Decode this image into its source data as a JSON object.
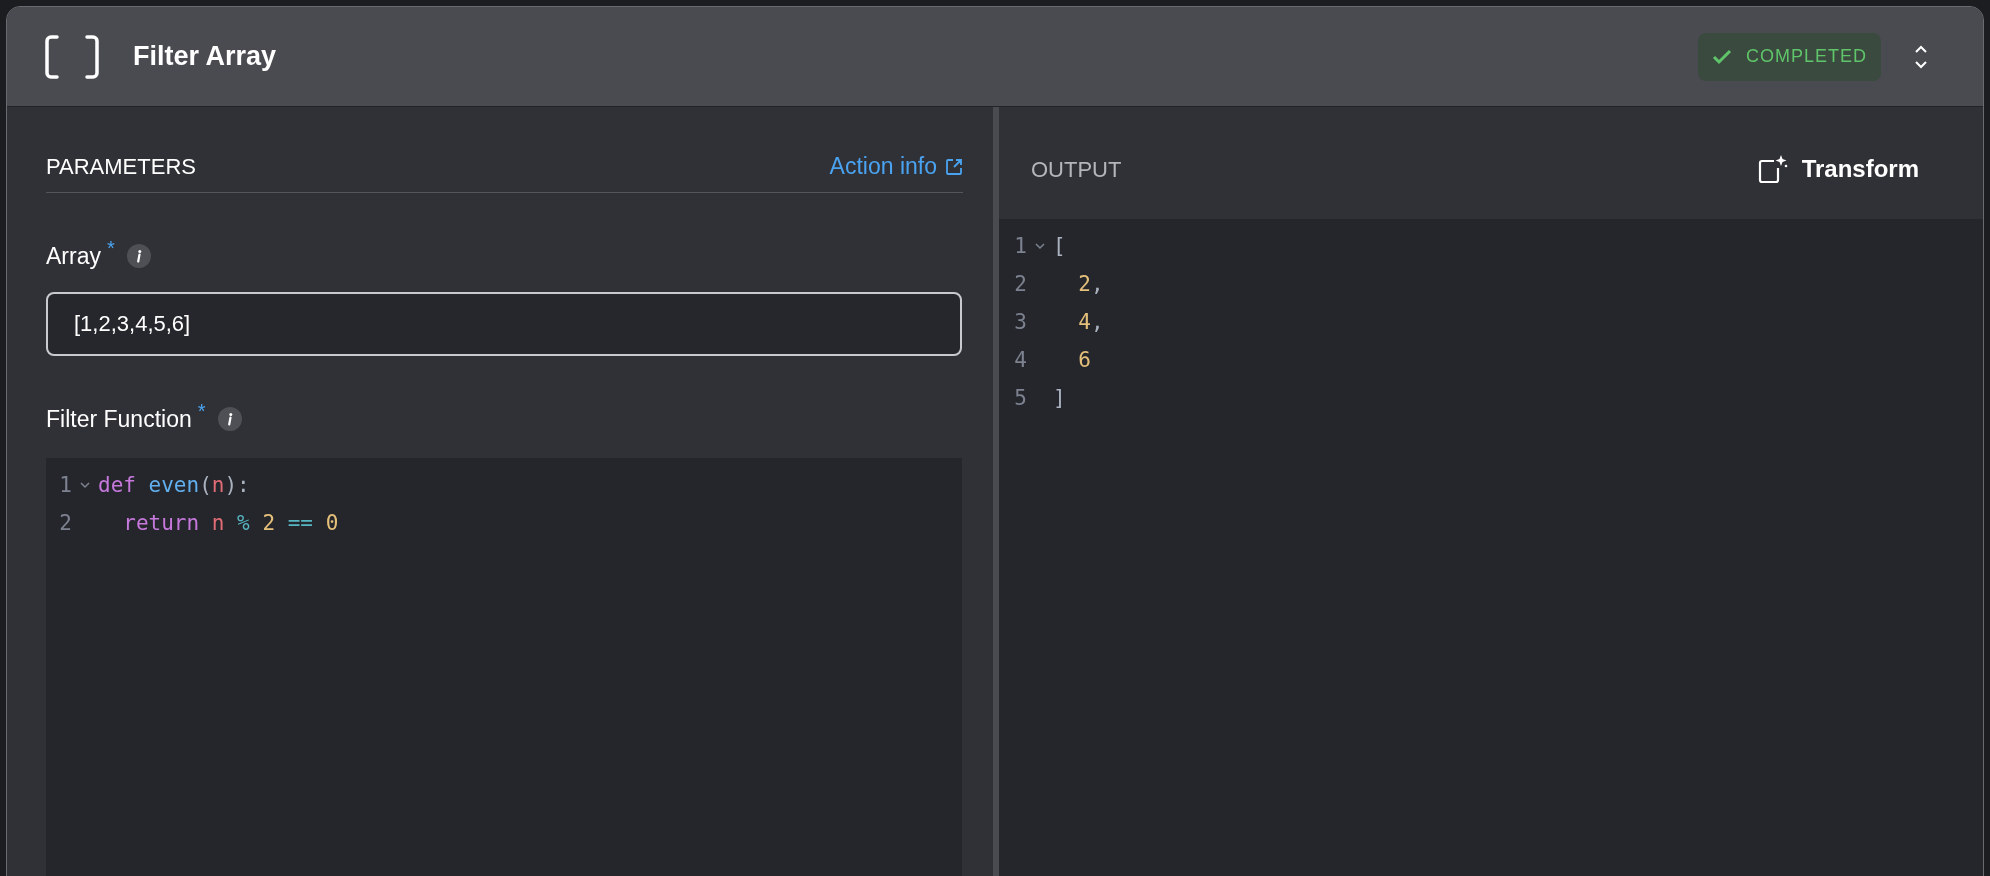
{
  "header": {
    "title": "Filter Array",
    "status": {
      "label": "COMPLETED",
      "kind": "success"
    }
  },
  "parameters": {
    "heading": "PARAMETERS",
    "link": "Action info",
    "fields": [
      {
        "kind": "input",
        "label": "Array",
        "required_mark": "*",
        "value": "[1,2,3,4,5,6]"
      },
      {
        "kind": "code",
        "label": "Filter Function",
        "required_mark": "*",
        "lines": [
          {
            "number": "1",
            "foldable": true,
            "tokens": [
              {
                "text": "def",
                "kind": "keyword"
              },
              {
                "text": " even",
                "kind": "function"
              },
              {
                "text": "(",
                "kind": "punct"
              },
              {
                "text": "n",
                "kind": "variable"
              },
              {
                "text": "):",
                "kind": "punct"
              }
            ]
          },
          {
            "number": "2",
            "foldable": false,
            "tokens": [
              {
                "text": "  return",
                "kind": "keyword"
              },
              {
                "text": " n",
                "kind": "variable"
              },
              {
                "text": " %",
                "kind": "operator"
              },
              {
                "text": " 2",
                "kind": "number"
              },
              {
                "text": " ==",
                "kind": "operator"
              },
              {
                "text": " 0",
                "kind": "number"
              }
            ]
          }
        ]
      }
    ]
  },
  "output": {
    "heading": "OUTPUT",
    "button": "Transform",
    "lines": [
      {
        "number": "1",
        "foldable": true,
        "tokens": [
          {
            "text": "[",
            "kind": "punct"
          }
        ]
      },
      {
        "number": "2",
        "foldable": false,
        "tokens": [
          {
            "text": "  2",
            "kind": "number"
          },
          {
            "text": ",",
            "kind": "punct"
          }
        ]
      },
      {
        "number": "3",
        "foldable": false,
        "tokens": [
          {
            "text": "  4",
            "kind": "number"
          },
          {
            "text": ",",
            "kind": "punct"
          }
        ]
      },
      {
        "number": "4",
        "foldable": false,
        "tokens": [
          {
            "text": "  6",
            "kind": "number"
          }
        ]
      },
      {
        "number": "5",
        "foldable": false,
        "tokens": [
          {
            "text": "]",
            "kind": "punct"
          }
        ]
      }
    ]
  }
}
